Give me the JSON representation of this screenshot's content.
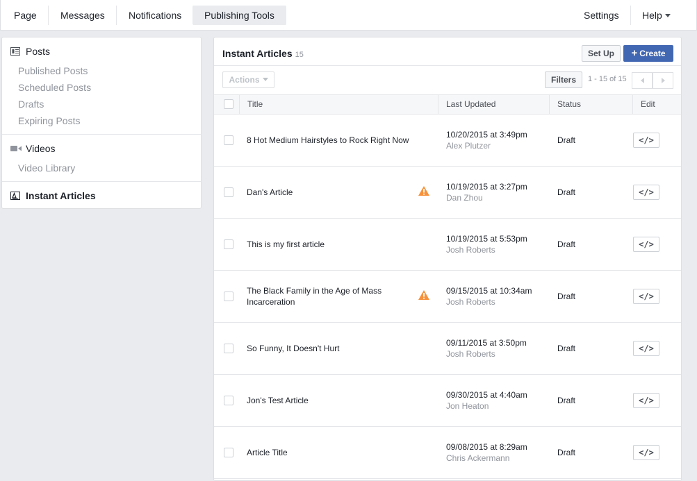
{
  "topnav": {
    "tabs": [
      "Page",
      "Messages",
      "Notifications",
      "Publishing Tools"
    ],
    "settings": "Settings",
    "help": "Help"
  },
  "sidebar": {
    "posts_header": "Posts",
    "posts_items": [
      "Published Posts",
      "Scheduled Posts",
      "Drafts",
      "Expiring Posts"
    ],
    "videos_header": "Videos",
    "videos_items": [
      "Video Library"
    ],
    "instant_articles": "Instant Articles"
  },
  "main": {
    "title": "Instant Articles",
    "count": "15",
    "setup_label": "Set Up",
    "create_label": "Create",
    "actions_label": "Actions",
    "filters_label": "Filters",
    "range_text": "1 - 15 of 15",
    "columns": [
      "Title",
      "Last Updated",
      "Status",
      "Edit"
    ],
    "edit_label": "</>",
    "rows": [
      {
        "title": "8 Hot Medium Hairstyles to Rock Right Now",
        "date": "10/20/2015 at 3:49pm",
        "author": "Alex Plutzer",
        "status": "Draft",
        "warning": false
      },
      {
        "title": "Dan's Article",
        "date": "10/19/2015 at 3:27pm",
        "author": "Dan Zhou",
        "status": "Draft",
        "warning": true
      },
      {
        "title": "This is my first article",
        "date": "10/19/2015 at 5:53pm",
        "author": "Josh Roberts",
        "status": "Draft",
        "warning": false
      },
      {
        "title": "The Black Family in the Age of Mass Incarceration",
        "date": "09/15/2015 at 10:34am",
        "author": "Josh Roberts",
        "status": "Draft",
        "warning": true
      },
      {
        "title": "So Funny, It Doesn't Hurt",
        "date": "09/11/2015 at 3:50pm",
        "author": "Josh Roberts",
        "status": "Draft",
        "warning": false
      },
      {
        "title": "Jon's Test Article",
        "date": "09/30/2015 at 4:40am",
        "author": "Jon Heaton",
        "status": "Draft",
        "warning": false
      },
      {
        "title": "Article Title",
        "date": "09/08/2015 at 8:29am",
        "author": "Chris Ackermann",
        "status": "Draft",
        "warning": false
      }
    ]
  },
  "colors": {
    "accent": "#4267b2",
    "warning": "#f7923b"
  }
}
